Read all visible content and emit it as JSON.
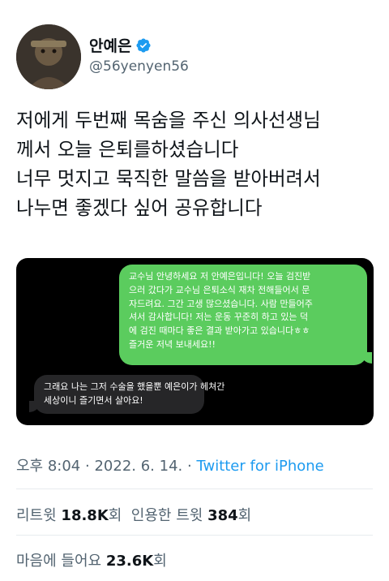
{
  "author": {
    "display_name": "안예은",
    "handle": "@56yenyen56",
    "verified_icon": "verified-badge-icon"
  },
  "tweet": {
    "lines": [
      "저에게 두번째 목숨을 주신 의사선생님",
      "께서 오늘 은퇴를하셨습니다",
      "너무 멋지고 묵직한 말씀을 받아버려서",
      "나누면 좋겠다 싶어 공유합니다"
    ]
  },
  "media": {
    "sent_message_lines": [
      "교수님 안녕하세요 저 안예은입니다! 오늘 검진받",
      "으러 갔다가 교수님 은퇴소식 재차 전해들어서 문",
      "자드려요. 그간 고생 많으셨습니다. 사람 만들어주",
      "셔서 감사합니다! 저는 운동 꾸준히 하고 있는 덕",
      "에 검진 때마다 좋은 결과 받아가고 있습니다ㅎㅎ",
      "즐거운 저녁 보내세요!!"
    ],
    "received_message_lines": [
      "그래요 나는 그저 수술을 했을뿐 예은이가 헤쳐간",
      "세상이니 즐기면서 살아요!"
    ]
  },
  "meta": {
    "time": "오후 8:04",
    "sep1": "·",
    "date": "2022. 6. 14.",
    "sep2": "·",
    "source": "Twitter for iPhone"
  },
  "stats": {
    "retweets_label": "리트윗",
    "retweets_count": "18.8K",
    "retweets_unit": "회",
    "quotes_label": "인용한 트윗",
    "quotes_count": "384",
    "quotes_unit": "회",
    "likes_label": "마음에 들어요",
    "likes_count": "23.6K",
    "likes_unit": "회"
  },
  "colors": {
    "accent": "#1d9bf0",
    "green_bubble": "#5bcc5e",
    "gray_bubble": "#262628",
    "secondary_text": "#536471"
  }
}
